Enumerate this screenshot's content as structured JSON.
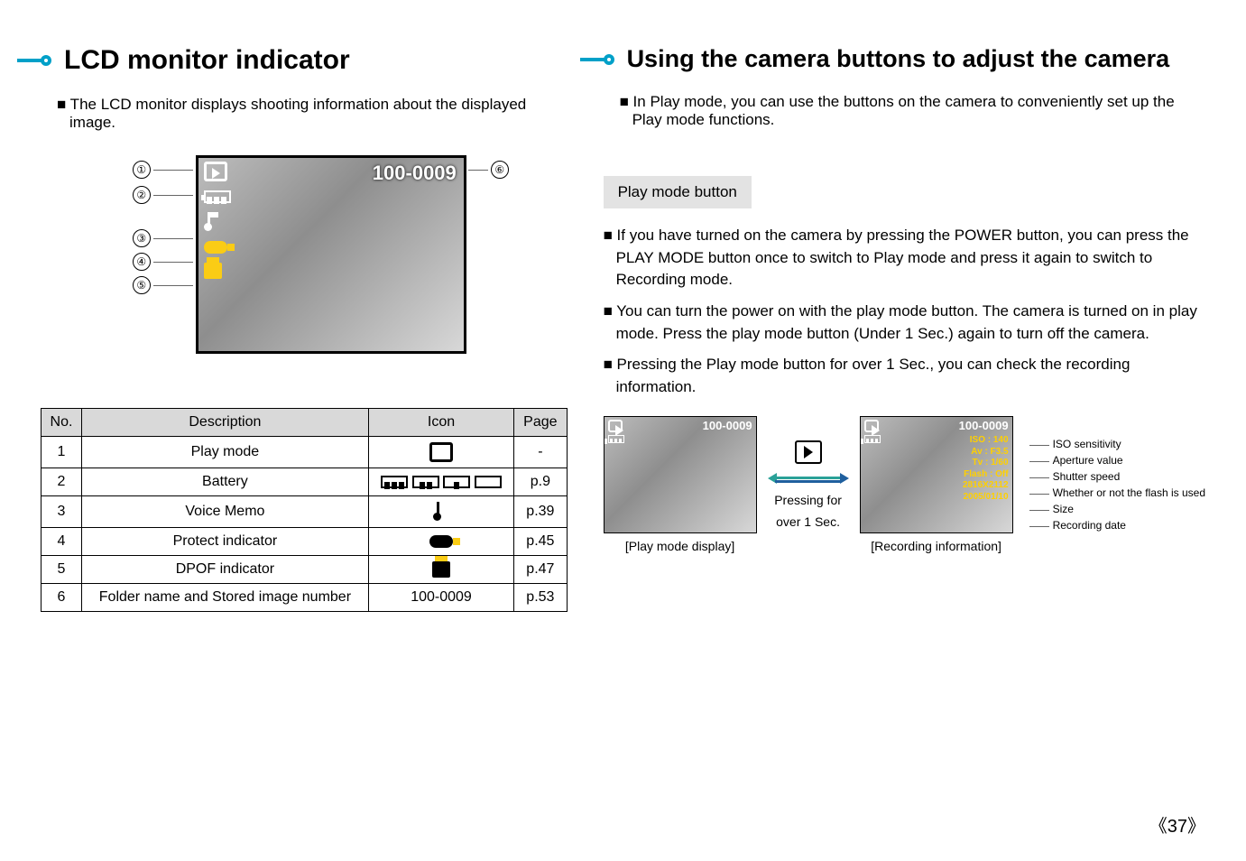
{
  "left": {
    "title": "LCD monitor indicator",
    "intro": "■ The LCD monitor displays shooting information about the displayed image.",
    "lcd": {
      "file_number": "100-0009",
      "callouts": [
        "①",
        "②",
        "③",
        "④",
        "⑤",
        "⑥"
      ]
    },
    "table": {
      "headers": {
        "no": "No.",
        "desc": "Description",
        "icon": "Icon",
        "page": "Page"
      },
      "rows": [
        {
          "no": "1",
          "desc": "Play mode",
          "icon_name": "play-mode-icon",
          "page": "-"
        },
        {
          "no": "2",
          "desc": "Battery",
          "icon_name": "battery-levels-icon",
          "page": "p.9"
        },
        {
          "no": "3",
          "desc": "Voice Memo",
          "icon_name": "voice-memo-icon",
          "page": "p.39"
        },
        {
          "no": "4",
          "desc": "Protect indicator",
          "icon_name": "protect-icon",
          "page": "p.45"
        },
        {
          "no": "5",
          "desc": "DPOF indicator",
          "icon_name": "dpof-icon",
          "page": "p.47"
        },
        {
          "no": "6",
          "desc": "Folder name and Stored image number",
          "icon_text": "100-0009",
          "page": "p.53"
        }
      ]
    }
  },
  "right": {
    "title": "Using the camera buttons to adjust the camera",
    "intro": "■ In Play mode, you can use the buttons on the camera to conveniently set up the Play mode functions.",
    "subhead": "Play mode button",
    "bullets": [
      "■ If you have turned on the camera by pressing the POWER button, you can press the PLAY MODE button once to switch to Play mode and press it again to switch to Recording mode.",
      "■ You can turn the power on with the play mode button. The camera is turned on in play mode. Press the play mode button (Under 1 Sec.) again to turn off the camera.",
      "■ Pressing the Play mode button for over 1 Sec., you can check the recording information."
    ],
    "thumbs": {
      "left_caption": "[Play mode display]",
      "right_caption": "[Recording information]",
      "file_number": "100-0009",
      "transition_label_1": "Pressing for",
      "transition_label_2": "over 1 Sec.",
      "info_lines": [
        "ISO : 140",
        "Av : F3.5",
        "Tv : 1/60",
        "Flash : Off",
        "2816X2112",
        "2005/01/10"
      ],
      "legend": [
        "ISO sensitivity",
        "Aperture value",
        "Shutter speed",
        "Whether or not the flash is used",
        "Size",
        "Recording date"
      ]
    }
  },
  "page_number": "37"
}
